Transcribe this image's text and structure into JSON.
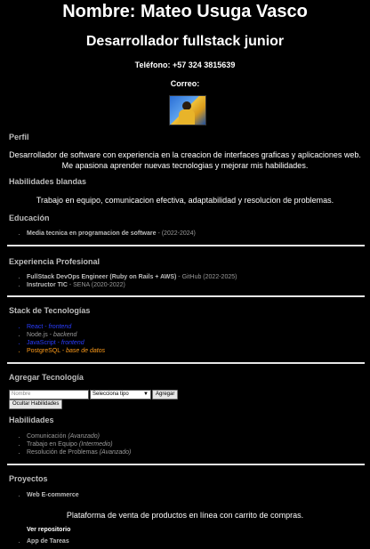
{
  "header": {
    "name": "Nombre: Mateo Usuga Vasco",
    "role": "Desarrollador fullstack junior",
    "phone": "Teléfono: +57 324 3815639",
    "email_label": "Correo:"
  },
  "profile": {
    "title": "Perfil",
    "text": "Desarrollador de software con experiencia en la creacion de interfaces graficas y aplicaciones web. Me apasiona aprender nuevas tecnologias y mejorar mis habilidades."
  },
  "soft_skills": {
    "title": "Habilidades blandas",
    "text": "Trabajo en equipo, comunicacion efectiva, adaptabilidad y resolucion de problemas."
  },
  "education": {
    "title": "Educación",
    "items": [
      {
        "name": "Media tecnica en programacion de software",
        "detail": " - (2022-2024)"
      }
    ]
  },
  "experience": {
    "title": "Experiencia Profesional",
    "items": [
      {
        "name": "FullStack DevOps Engineer (Ruby on Rails + AWS)",
        "detail": " - GitHub (2022-2025)"
      },
      {
        "name": "Instructor TIC",
        "detail": " - SENA (2020-2022)"
      }
    ]
  },
  "stack": {
    "title": "Stack de Tecnologías",
    "items": [
      {
        "name": "React",
        "sep": " - ",
        "type": "frontend",
        "color": "#2a3dff"
      },
      {
        "name": "Node.js",
        "sep": " - ",
        "type": "backend",
        "color": "#9a9a9a"
      },
      {
        "name": "JavaScript",
        "sep": " - ",
        "type": "frontend",
        "color": "#2a3dff"
      },
      {
        "name": "PostgreSQL",
        "sep": " - ",
        "type": "base de datos",
        "color": "#ff9c1a"
      }
    ]
  },
  "add_tech": {
    "title": "Agregar Tecnología",
    "name_placeholder": "Nombre",
    "type_select": "Selecciona tipo",
    "add_button": "Agregar",
    "hide_button": "Ocultar Habilidades"
  },
  "skills": {
    "title": "Habilidades",
    "items": [
      {
        "name": "Comunicación",
        "level": "(Avanzado)"
      },
      {
        "name": "Trabajo en Equipo",
        "level": "(Intermedio)"
      },
      {
        "name": "Resolución de Problemas",
        "level": "(Avanzado)"
      }
    ]
  },
  "projects": {
    "title": "Proyectos",
    "items": [
      {
        "name": "Web E-commerce",
        "description": "Plataforma de venta de productos en línea con carrito de compras.",
        "link": "Ver repositorio"
      },
      {
        "name": "App de Tareas"
      }
    ]
  }
}
